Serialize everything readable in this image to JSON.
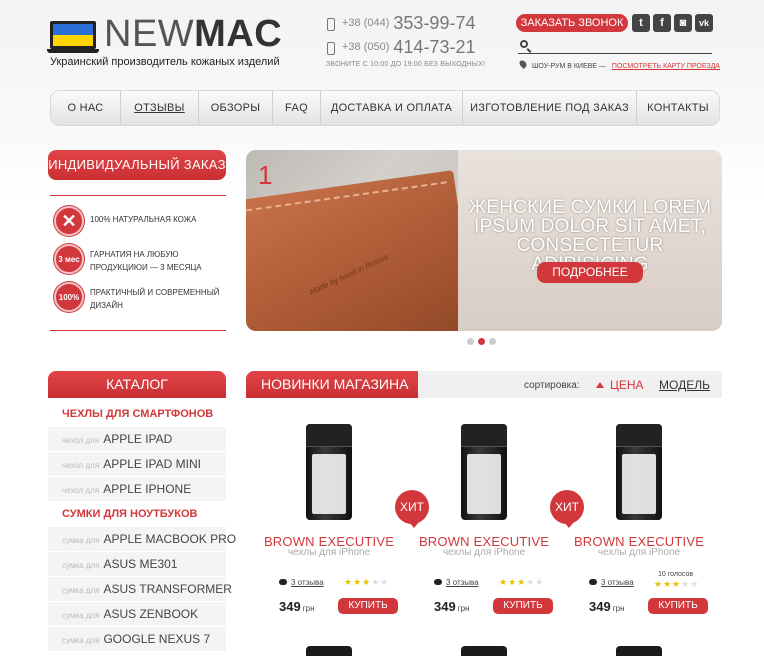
{
  "header": {
    "brand_thin": "NEW",
    "brand_bold": "MAC",
    "tagline": "Украинский производитель кожаных изделий",
    "phones": [
      {
        "code": "+38 (044)",
        "number": "353-99-74"
      },
      {
        "code": "+38 (050)",
        "number": "414-73-21"
      }
    ],
    "hours": "ЗВОНИТЕ С 10:00 ДО 19:00 БЕЗ ВЫХОДНЫХ!",
    "callback_label": "ЗАКАЗАТЬ ЗВОНОК",
    "social": [
      "t",
      "f",
      "◙",
      "vk"
    ],
    "search_placeholder": "",
    "showroom_text": "ШОУ-РУМ В КИЕВЕ —",
    "showroom_link": "ПОСМОТРЕТЬ КАРТУ ПРОЕЗДА"
  },
  "nav": [
    "О НАС",
    "ОТЗЫВЫ",
    "ОБЗОРЫ",
    "FAQ",
    "ДОСТАВКА И ОПЛАТА",
    "ИЗГОТОВЛЕНИЕ ПОД ЗАКАЗ",
    "КОНТАКТЫ"
  ],
  "sidebar": {
    "custom_order_label": "ИНДИВИДУАЛЬНЫЙ ЗАКАЗ",
    "features": [
      {
        "badge": "",
        "text": "100% НАТУРАЛЬНАЯ КОЖА"
      },
      {
        "badge": "3 мес",
        "text": "ГАРНАТИЯ НА ЛЮБУЮ ПРОДУКЦИЮИ — 3 МЕСЯЦА"
      },
      {
        "badge": "100%",
        "text": "ПРАКТИЧНЫЙ И СОВРЕМЕННЫЙ ДИЗАЙН"
      }
    ],
    "catalog_title": "КАТАЛОГ",
    "catalog": [
      {
        "type": "section",
        "label": "ЧЕХЛЫ ДЛЯ СМАРТФОНОВ"
      },
      {
        "type": "item",
        "prefix": "чехол для",
        "label": "APPLE IPAD"
      },
      {
        "type": "item",
        "prefix": "чехол для",
        "label": "APPLE IPAD MINI"
      },
      {
        "type": "item",
        "prefix": "чехол для",
        "label": "APPLE IPHONE"
      },
      {
        "type": "section",
        "label": "СУМКИ ДЛЯ НОУТБУКОВ"
      },
      {
        "type": "item",
        "prefix": "сумка для",
        "label": "APPLE MACBOOK PRO"
      },
      {
        "type": "item",
        "prefix": "сумка для",
        "label": "ASUS ME301"
      },
      {
        "type": "item",
        "prefix": "сумка для",
        "label": "ASUS TRANSFORMER"
      },
      {
        "type": "item",
        "prefix": "сумка для",
        "label": "ASUS ZENBOOK"
      },
      {
        "type": "item",
        "prefix": "сумка для",
        "label": "GOOGLE NEXUS 7"
      }
    ]
  },
  "slider": {
    "slide_number": "1",
    "headline": "ЖЕНСКИЕ СУМКИ LOREM IPSUM DOLOR SIT AMET, CONSECTETUR ADIPISICING",
    "more_label": "ПОДРОБНЕЕ",
    "emboss": "Made by hand in Russia",
    "dots": 3,
    "active_dot": 2
  },
  "products": {
    "title": "НОВИНКИ МАГАЗИНА",
    "sort_label": "сортировка:",
    "sort_price": "ЦЕНА",
    "sort_model": "МОДЕЛЬ",
    "items": [
      {
        "title": "BROWN EXECUTIVE",
        "subtitle": "чехлы для iPhone",
        "hit": "",
        "votes": "",
        "reviews": "3 отзыва",
        "stars": 3,
        "price": "349",
        "currency": "грн",
        "buy": "КУПИТЬ"
      },
      {
        "title": "BROWN EXECUTIVE",
        "subtitle": "чехлы для iPhone",
        "hit": "ХИТ",
        "votes": "",
        "reviews": "3 отзыва",
        "stars": 3,
        "price": "349",
        "currency": "грн",
        "buy": "КУПИТЬ"
      },
      {
        "title": "BROWN EXECUTIVE",
        "subtitle": "чехлы для iPhone",
        "hit": "ХИТ",
        "votes": "10 голосов",
        "reviews": "3 отзыва",
        "stars": 3,
        "price": "349",
        "currency": "грн",
        "buy": "КУПИТЬ"
      }
    ]
  },
  "colors": {
    "accent": "#d2383b"
  }
}
